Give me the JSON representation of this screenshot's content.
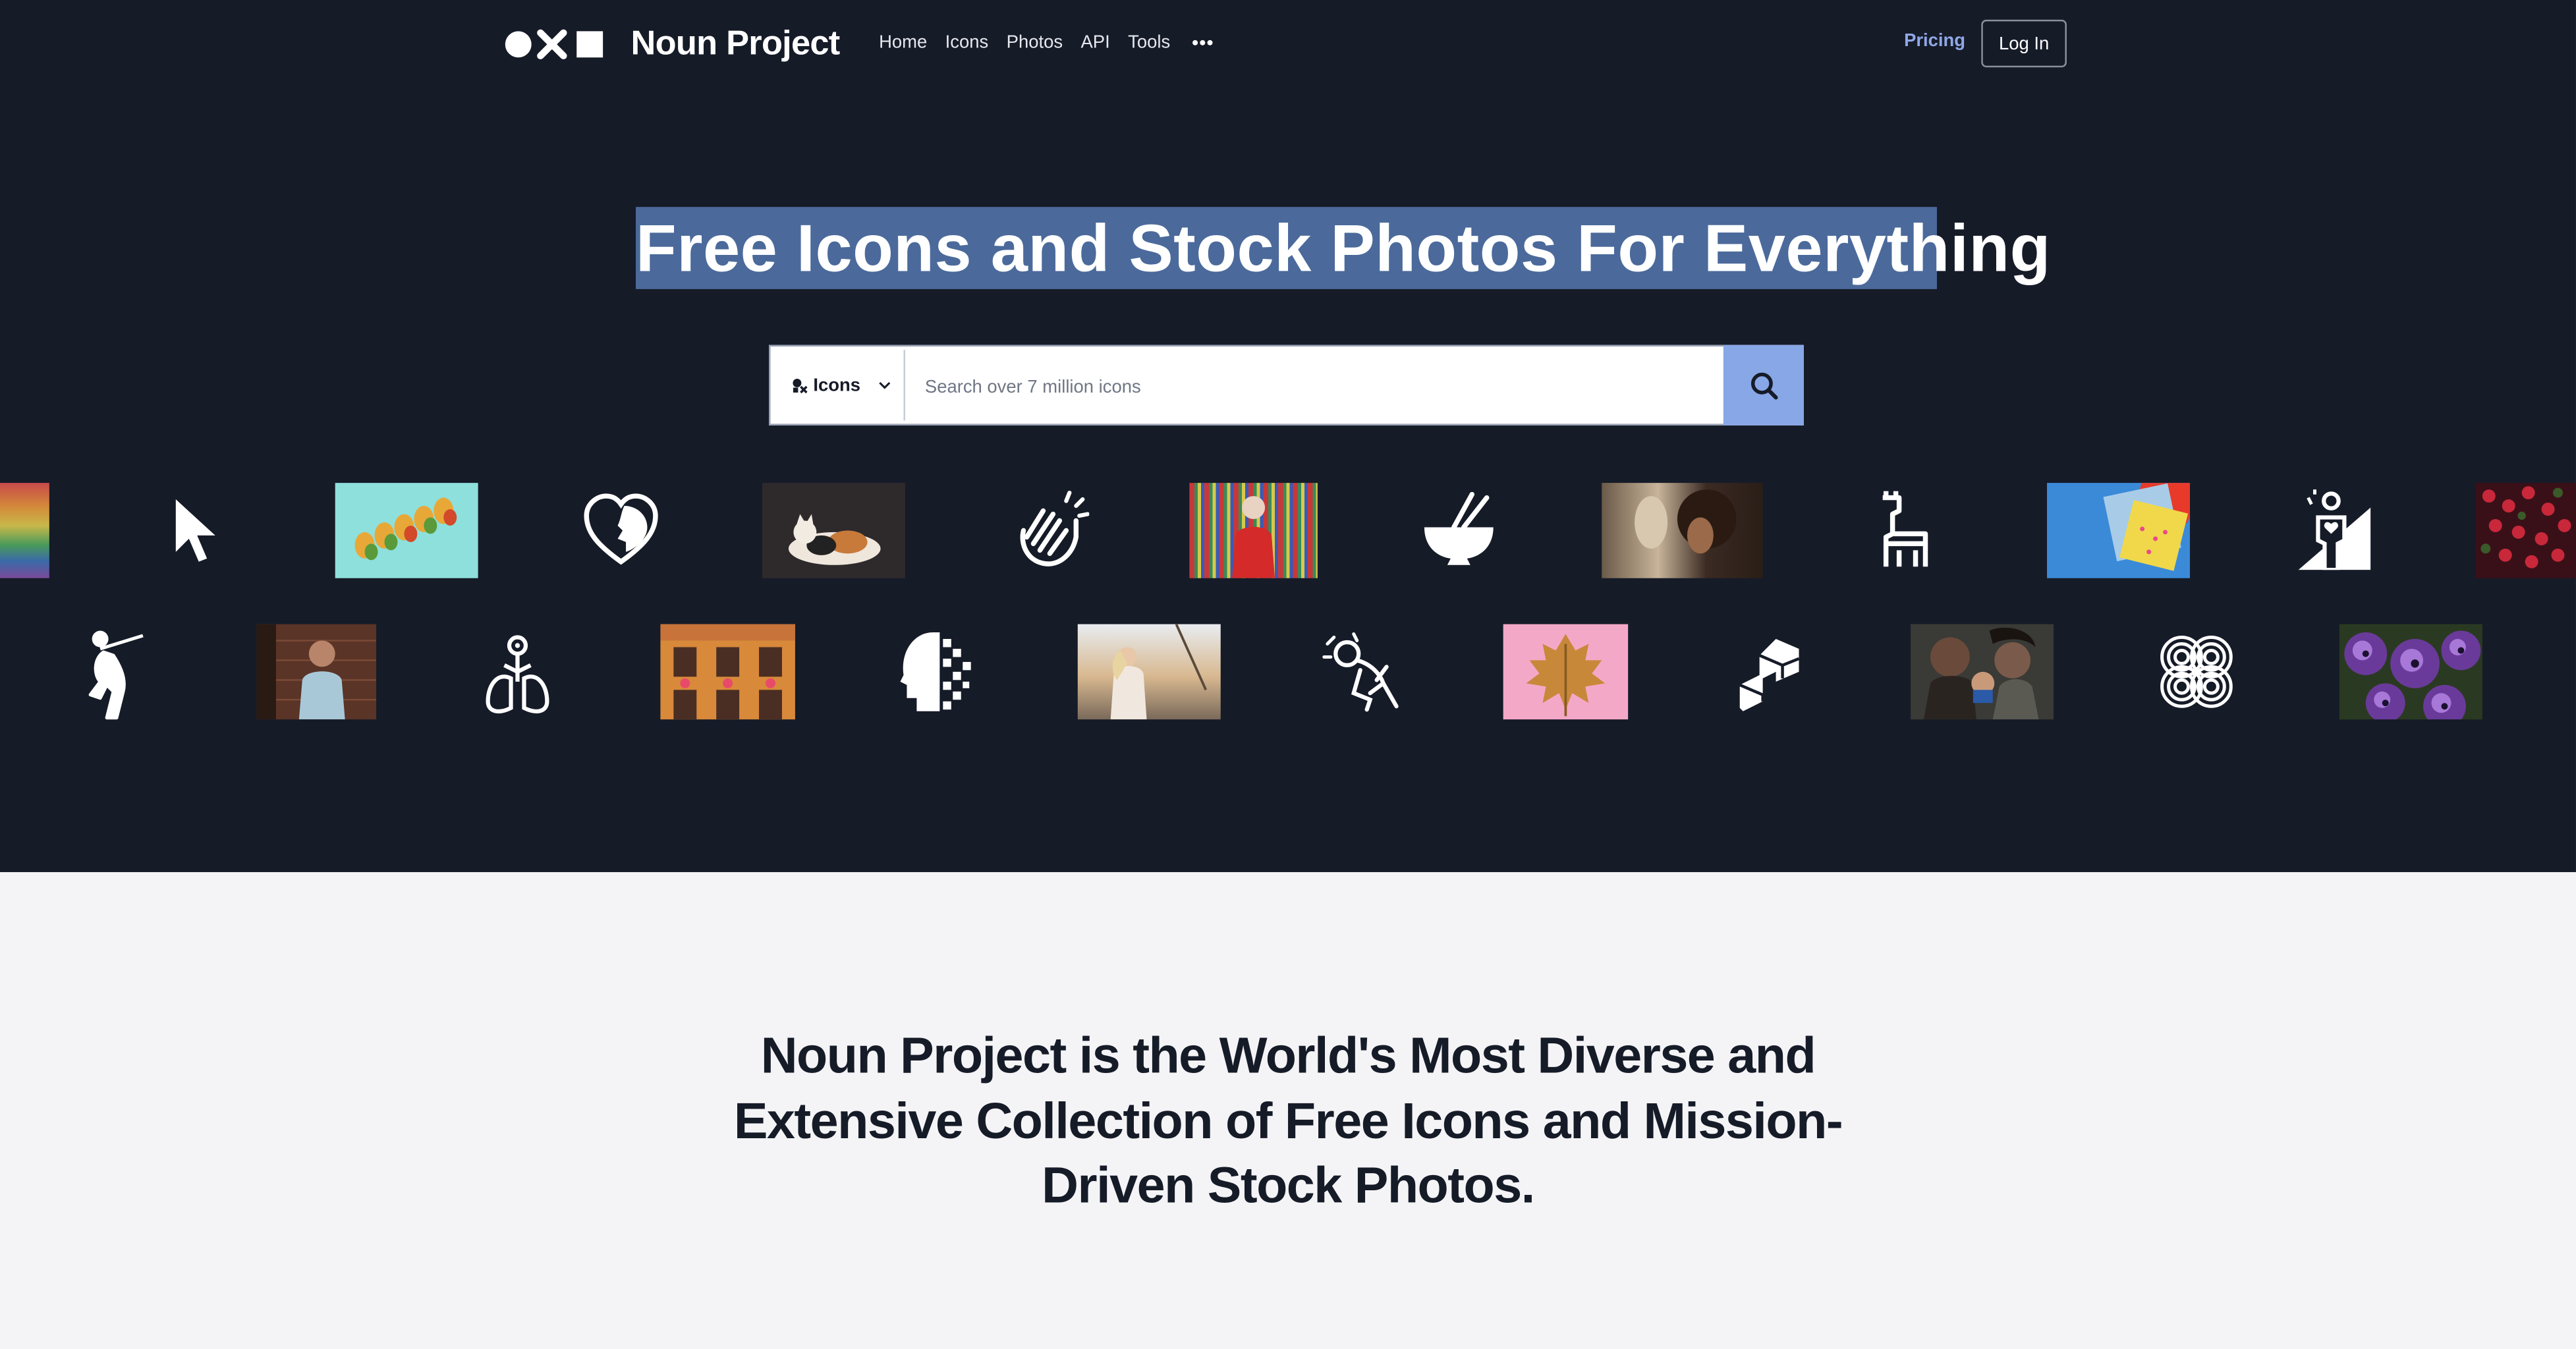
{
  "nav": {
    "brand": "Noun Project",
    "links": [
      "Home",
      "Icons",
      "Photos",
      "API",
      "Tools"
    ],
    "pricing": "Pricing",
    "login": "Log In"
  },
  "hero": {
    "headline": "Free Icons and Stock Photos For Everything",
    "search": {
      "type_label": "Icons",
      "placeholder": "Search over 7 million icons"
    }
  },
  "mosaic": {
    "row1": [
      "rainbow-photo",
      "cursor-icon",
      "pears-photo",
      "heart-face-icon",
      "calico-cat-photo",
      "clapping-hands-icon",
      "person-red-jacket-photo",
      "bowl-chopsticks-icon",
      "curly-hair-woman-photo",
      "llama-icon",
      "floppy-disk-photo",
      "person-heart-ramp-icon",
      "red-berries-photo"
    ],
    "row2": [
      "dancer-icon",
      "man-brick-wall-photo",
      "lungs-flower-icon",
      "heart-windows-building-photo",
      "pixel-head-icon",
      "woman-sailboat-photo",
      "kneeling-figure-icon",
      "pink-leaf-photo",
      "isometric-blocks-icon",
      "family-baby-photo",
      "spiral-knot-icon",
      "purple-flowers-photo"
    ]
  },
  "about": {
    "tagline": "Noun Project is the World's Most Diverse and Extensive Collection of Free Icons and Mission-Driven Stock Photos."
  },
  "colors": {
    "hero_bg": "#161b28",
    "accent": "#88a7e6",
    "selection": "#4b6a9b",
    "lower_bg": "#f4f4f6"
  }
}
